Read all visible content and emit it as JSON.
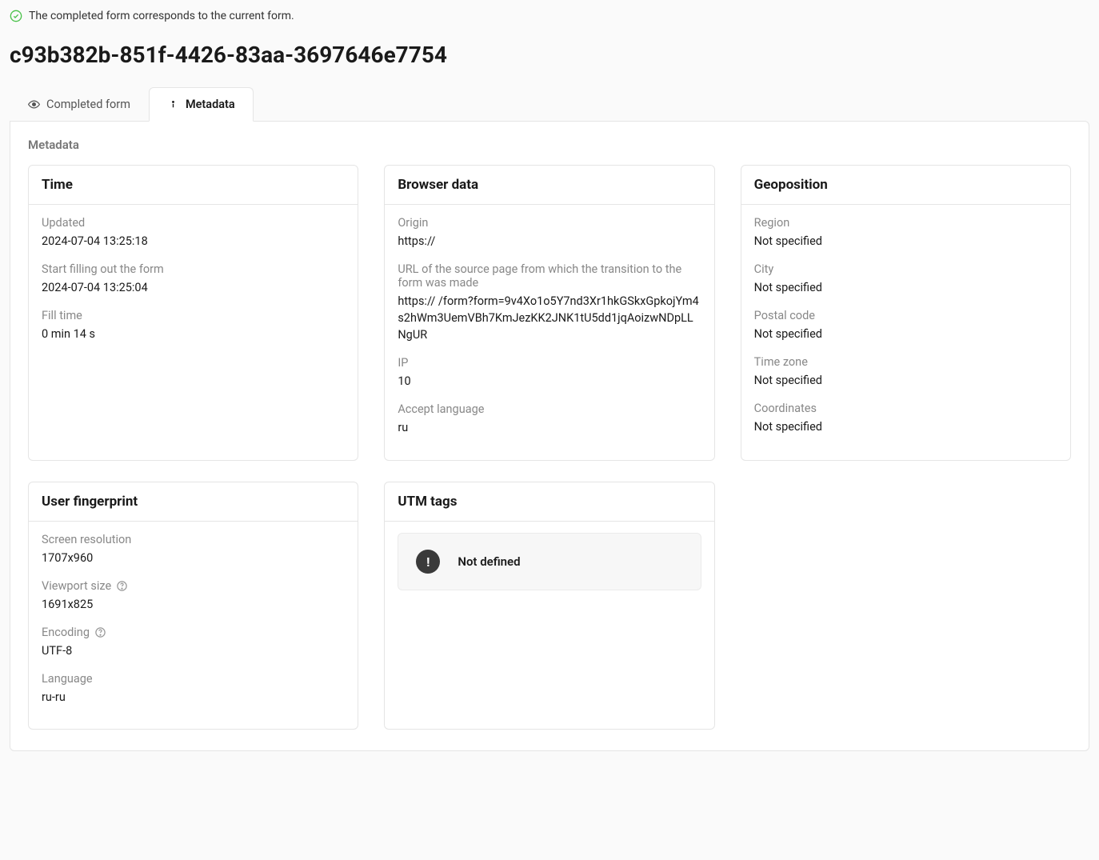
{
  "status_message": "The completed form corresponds to the current form.",
  "page_title": "c93b382b-851f-4426-83aa-3697646e7754",
  "tabs": {
    "completed_form": "Completed form",
    "metadata": "Metadata"
  },
  "section_label": "Metadata",
  "cards": {
    "time": {
      "title": "Time",
      "updated_label": "Updated",
      "updated_value": "2024-07-04 13:25:18",
      "start_label": "Start filling out the form",
      "start_value": "2024-07-04 13:25:04",
      "fill_label": "Fill time",
      "fill_value": "0 min 14 s"
    },
    "browser": {
      "title": "Browser data",
      "origin_label": "Origin",
      "origin_value": "https://",
      "url_label": "URL of the source page from which the transition to the form was made",
      "url_value": "https://                                                                  /form?form=9v4Xo1o5Y7nd3Xr1hkGSkxGpkojYm4s2hWm3UemVBh7KmJezKK2JNK1tU5dd1jqAoizwNDpLLNgUR",
      "ip_label": "IP",
      "ip_value": "10",
      "accept_lang_label": "Accept language",
      "accept_lang_value": "ru"
    },
    "geo": {
      "title": "Geoposition",
      "region_label": "Region",
      "region_value": "Not specified",
      "city_label": "City",
      "city_value": "Not specified",
      "postal_label": "Postal code",
      "postal_value": "Not specified",
      "tz_label": "Time zone",
      "tz_value": "Not specified",
      "coords_label": "Coordinates",
      "coords_value": "Not specified"
    },
    "fingerprint": {
      "title": "User fingerprint",
      "res_label": "Screen resolution",
      "res_value": "1707x960",
      "vp_label": "Viewport size",
      "vp_value": "1691x825",
      "enc_label": "Encoding",
      "enc_value": "UTF-8",
      "lang_label": "Language",
      "lang_value": "ru-ru"
    },
    "utm": {
      "title": "UTM tags",
      "not_defined": "Not defined"
    }
  }
}
